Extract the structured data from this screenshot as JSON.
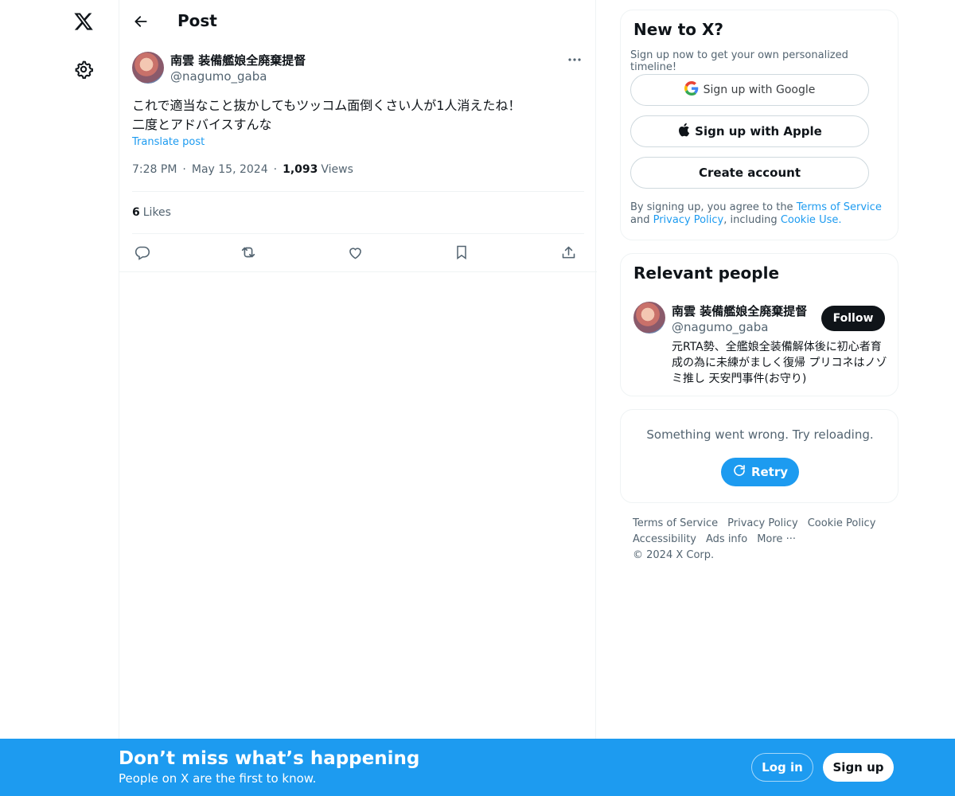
{
  "nav": {
    "logo_icon": "x-logo-icon",
    "settings_icon": "gear-icon"
  },
  "header": {
    "title": "Post"
  },
  "post": {
    "author_name": "南雲 装備艦娘全廃棄提督",
    "author_handle": "@nagumo_gaba",
    "text": "これで適当なこと抜かしてもツッコム面倒くさい人が1人消えたね！\n二度とアドバイスすんな",
    "translate_label": "Translate post",
    "time": "7:28 PM",
    "date": "May 15, 2024",
    "views_count": "1,093",
    "views_label": "Views",
    "likes_count": "6",
    "likes_label": "Likes"
  },
  "signup_card": {
    "title": "New to X?",
    "subtitle": "Sign up now to get your own personalized timeline!",
    "google_label": "Sign up with Google",
    "apple_label": "Sign up with Apple",
    "create_label": "Create account",
    "legal_prefix": "By signing up, you agree to the ",
    "terms_label": "Terms of Service",
    "and_label": " and ",
    "privacy_label": "Privacy Policy",
    "including_label": ", including ",
    "cookie_label": "Cookie Use."
  },
  "relevant": {
    "title": "Relevant people",
    "name": "南雲 装備艦娘全廃棄提督",
    "handle": "@nagumo_gaba",
    "follow_label": "Follow",
    "bio": "元RTA勢、全艦娘全装備解体後に初心者育成の為に未練がましく復帰 プリコネはノゾミ推し 天安門事件(お守り)"
  },
  "error_card": {
    "message": "Something went wrong. Try reloading.",
    "retry_label": "Retry"
  },
  "footer": {
    "links": [
      "Terms of Service",
      "Privacy Policy",
      "Cookie Policy",
      "Accessibility",
      "Ads info",
      "More ···",
      "© 2024 X Corp."
    ]
  },
  "bottom_bar": {
    "title": "Don’t miss what’s happening",
    "subtitle": "People on X are the first to know.",
    "login_label": "Log in",
    "signup_label": "Sign up"
  },
  "colors": {
    "accent": "#1d9bf0",
    "text": "#0f1419",
    "muted": "#536471",
    "border": "#eff3f4"
  }
}
